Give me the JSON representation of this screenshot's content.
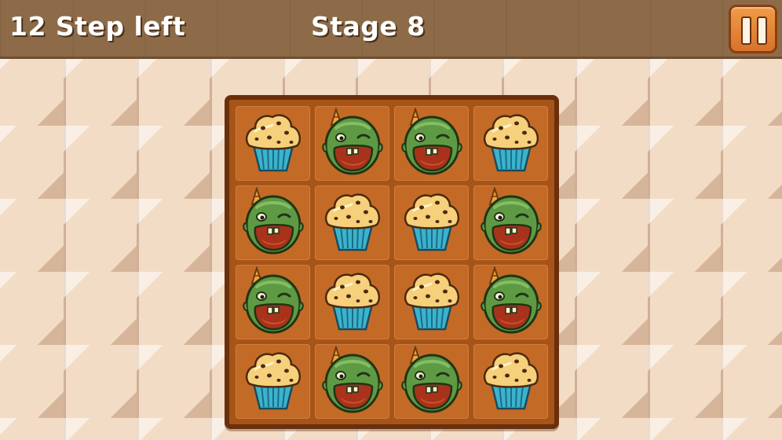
{
  "hud": {
    "steps_label": "12 Step left",
    "stage_label": "Stage 8",
    "pause_icon": "pause-icon"
  },
  "board": {
    "rows": 4,
    "cols": 4,
    "tiles": [
      [
        "muffin",
        "zombie",
        "zombie",
        "muffin"
      ],
      [
        "zombie",
        "muffin",
        "muffin",
        "zombie"
      ],
      [
        "zombie",
        "muffin",
        "muffin",
        "zombie"
      ],
      [
        "muffin",
        "zombie",
        "zombie",
        "muffin"
      ]
    ]
  },
  "colors": {
    "hud_bar": "#8d6b48",
    "board_frame": "#6a2f0c",
    "tile_bg": "#c46a27",
    "pause_button": "#e5843a"
  }
}
